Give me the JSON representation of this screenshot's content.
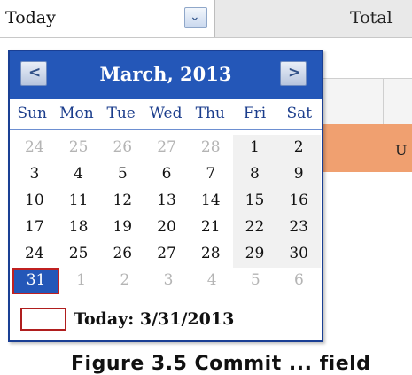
{
  "toolbar": {
    "date_range_value": "Today",
    "dropdown_icon": "chevron-down-icon",
    "total_label": "Total"
  },
  "background": {
    "orange_header_text": "U"
  },
  "calendar": {
    "prev_icon": "chevron-left-icon",
    "next_icon": "chevron-right-icon",
    "prev_glyph": "<",
    "next_glyph": ">",
    "month_title": "March, 2013",
    "weekdays": [
      "Sun",
      "Mon",
      "Tue",
      "Wed",
      "Thu",
      "Fri",
      "Sat"
    ],
    "weeks": [
      [
        {
          "d": "24",
          "other": true
        },
        {
          "d": "25",
          "other": true
        },
        {
          "d": "26",
          "other": true
        },
        {
          "d": "27",
          "other": true
        },
        {
          "d": "28",
          "other": true
        },
        {
          "d": "1"
        },
        {
          "d": "2"
        }
      ],
      [
        {
          "d": "3"
        },
        {
          "d": "4"
        },
        {
          "d": "5"
        },
        {
          "d": "6"
        },
        {
          "d": "7"
        },
        {
          "d": "8"
        },
        {
          "d": "9"
        }
      ],
      [
        {
          "d": "10"
        },
        {
          "d": "11"
        },
        {
          "d": "12"
        },
        {
          "d": "13"
        },
        {
          "d": "14"
        },
        {
          "d": "15"
        },
        {
          "d": "16"
        }
      ],
      [
        {
          "d": "17"
        },
        {
          "d": "18"
        },
        {
          "d": "19"
        },
        {
          "d": "20"
        },
        {
          "d": "21"
        },
        {
          "d": "22"
        },
        {
          "d": "23"
        }
      ],
      [
        {
          "d": "24"
        },
        {
          "d": "25"
        },
        {
          "d": "26"
        },
        {
          "d": "27"
        },
        {
          "d": "28"
        },
        {
          "d": "29"
        },
        {
          "d": "30"
        }
      ],
      [
        {
          "d": "31",
          "selected": true
        },
        {
          "d": "1",
          "other": true
        },
        {
          "d": "2",
          "other": true
        },
        {
          "d": "3",
          "other": true
        },
        {
          "d": "4",
          "other": true
        },
        {
          "d": "5",
          "other": true
        },
        {
          "d": "6",
          "other": true
        }
      ]
    ],
    "today_label": "Today: 3/31/2013",
    "colors": {
      "header_bg": "#2457b8",
      "selected_border": "#c02020",
      "other_month_text": "#b4b4b4"
    }
  },
  "caption": "Figure 3.5 Commit ... field"
}
